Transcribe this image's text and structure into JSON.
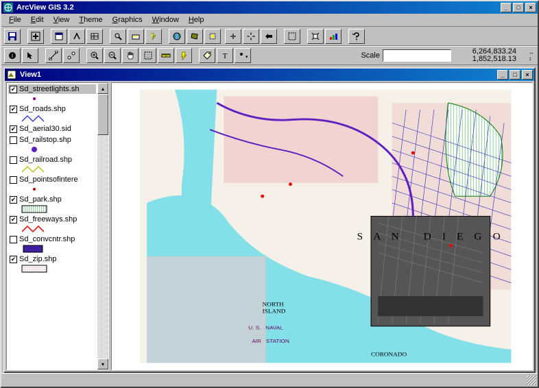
{
  "window": {
    "title": "ArcView GIS 3.2"
  },
  "menus": [
    "File",
    "Edit",
    "View",
    "Theme",
    "Graphics",
    "Window",
    "Help"
  ],
  "scale": {
    "label": "Scale",
    "value": ""
  },
  "coords": {
    "x": "6,264,833.24",
    "y": "1,852,518.13"
  },
  "view": {
    "title": "View1"
  },
  "layers": [
    {
      "name": "Sd_streetlights.sh",
      "checked": true,
      "selected": true,
      "sym": "dot",
      "symColor": "#800080"
    },
    {
      "name": "Sd_roads.shp",
      "checked": true,
      "sym": "zigzag",
      "symColor": "#4040c0"
    },
    {
      "name": "Sd_aerial30.sid",
      "checked": true,
      "sym": "none"
    },
    {
      "name": "Sd_railstop.shp",
      "checked": false,
      "sym": "bigdot",
      "symColor": "#6020c0"
    },
    {
      "name": "Sd_railroad.shp",
      "checked": false,
      "sym": "zigzag",
      "symColor": "#c0c020"
    },
    {
      "name": "Sd_pointsofintere",
      "checked": false,
      "sym": "dot",
      "symColor": "#c00000"
    },
    {
      "name": "Sd_park.shp",
      "checked": true,
      "sym": "hatch",
      "symColor": "#20a040"
    },
    {
      "name": "Sd_freeways.shp",
      "checked": true,
      "sym": "zigzag",
      "symColor": "#e00000"
    },
    {
      "name": "Sd_convcntr.shp",
      "checked": false,
      "sym": "rect",
      "symColor": "#4020a0"
    },
    {
      "name": "Sd_zip.shp",
      "checked": true,
      "sym": "dotrect",
      "symColor": "#e0a0a0"
    }
  ]
}
